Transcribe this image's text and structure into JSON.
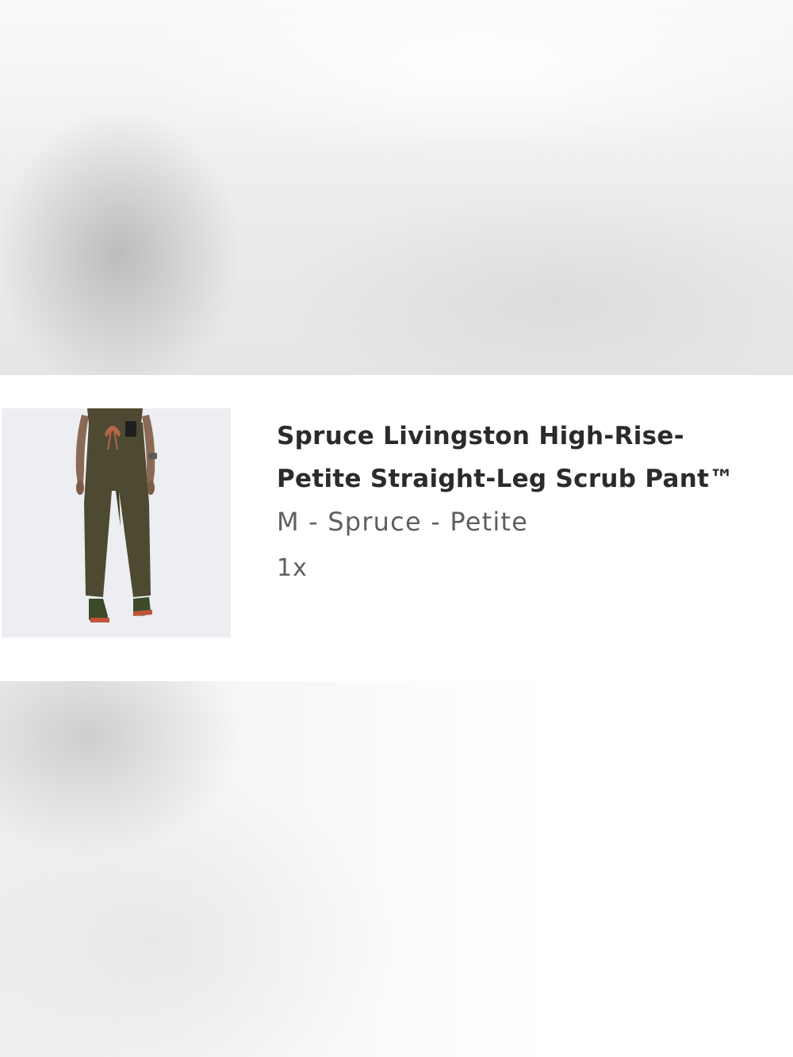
{
  "product": {
    "title_line1": "Spruce Livingston High-Rise-",
    "title_line2": "Petite Straight-Leg Scrub Pant™",
    "variant": "M - Spruce - Petite",
    "quantity": "1x",
    "image_alt": "Spruce Livingston High-Rise-Petite Straight-Leg Scrub Pant"
  },
  "colors": {
    "card_background": "#ffffff",
    "title": "#2b2b2b",
    "secondary_text": "#5f5f5f",
    "product_color": "#4e4a32",
    "drawstring": "#b4654a"
  },
  "icons": {
    "product_image": "product-thumbnail"
  }
}
